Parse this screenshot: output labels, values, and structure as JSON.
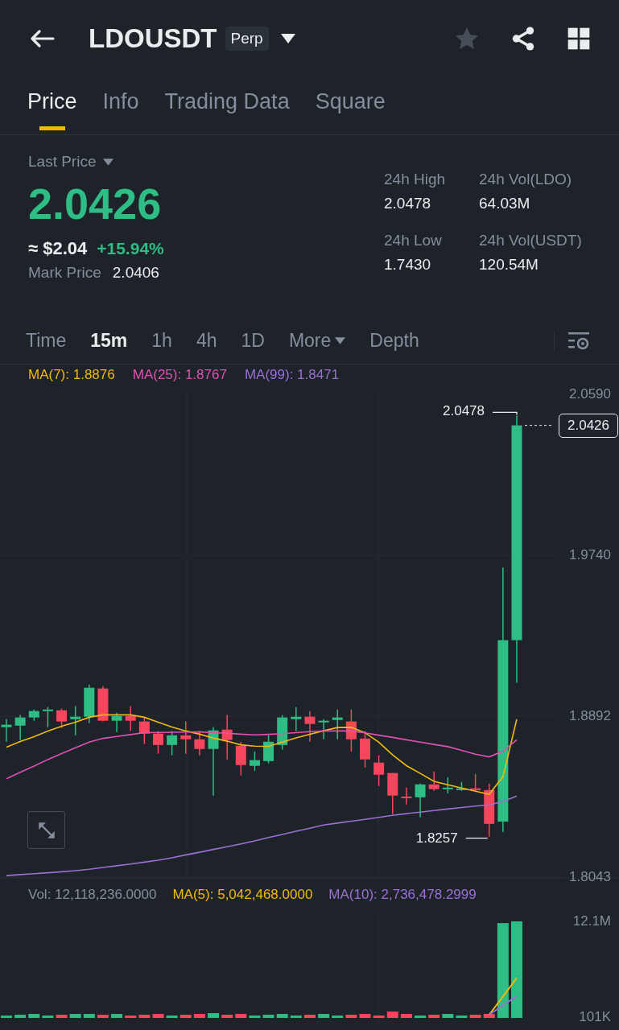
{
  "header": {
    "symbol": "LDOUSDT",
    "badge": "Perp",
    "favorite": false
  },
  "tabs": [
    {
      "label": "Price",
      "selected": true
    },
    {
      "label": "Info",
      "selected": false
    },
    {
      "label": "Trading Data",
      "selected": false
    },
    {
      "label": "Square",
      "selected": false
    }
  ],
  "ticker": {
    "label": "Last Price",
    "last_price": "2.0426",
    "fiat_price": "≈ $2.04",
    "change": "+15.94%",
    "mark_label": "Mark Price",
    "mark_price": "2.0406"
  },
  "stats": [
    {
      "label": "24h High",
      "value": "2.0478"
    },
    {
      "label": "24h Vol(LDO)",
      "value": "64.03M"
    },
    {
      "label": "24h Low",
      "value": "1.7430"
    },
    {
      "label": "24h Vol(USDT)",
      "value": "120.54M"
    }
  ],
  "intervals": [
    {
      "label": "Time",
      "selected": false,
      "dropdown": false
    },
    {
      "label": "15m",
      "selected": true,
      "dropdown": false
    },
    {
      "label": "1h",
      "selected": false,
      "dropdown": false
    },
    {
      "label": "4h",
      "selected": false,
      "dropdown": false
    },
    {
      "label": "1D",
      "selected": false,
      "dropdown": false
    },
    {
      "label": "More",
      "selected": false,
      "dropdown": true
    },
    {
      "label": "Depth",
      "selected": false,
      "dropdown": false
    }
  ],
  "price_chart": {
    "high_label": "2.0478",
    "low_label": "1.8257",
    "current_price": "2.0426",
    "chart_data": {
      "type": "candlestick",
      "ylim": [
        1.8043,
        2.059
      ],
      "yticks": [
        {
          "value": 2.059,
          "label": "2.0590"
        },
        {
          "value": 1.974,
          "label": "1.9740"
        },
        {
          "value": 1.8892,
          "label": "1.8892"
        },
        {
          "value": 1.8043,
          "label": "1.8043"
        }
      ],
      "categories": [
        null,
        null,
        null,
        null,
        null,
        null,
        null,
        null,
        null,
        null,
        null,
        null,
        null,
        null,
        null,
        null,
        null,
        null,
        null,
        null,
        null,
        null,
        null,
        null,
        null,
        null,
        null,
        null,
        null,
        null,
        null,
        null,
        null,
        null,
        null,
        null,
        null,
        null
      ],
      "ohlc": [
        [
          1.8834,
          1.8876,
          1.8757,
          1.8847
        ],
        [
          1.8842,
          1.8898,
          1.8766,
          1.8885
        ],
        [
          1.8885,
          1.8927,
          1.8868,
          1.8919
        ],
        [
          1.8919,
          1.894,
          1.8834,
          1.8927
        ],
        [
          1.8923,
          1.8932,
          1.883,
          1.8864
        ],
        [
          1.8876,
          1.8945,
          1.8791,
          1.8889
        ],
        [
          1.8889,
          1.9059,
          1.8855,
          1.9042
        ],
        [
          1.9038,
          1.9051,
          1.8864,
          1.8868
        ],
        [
          1.8868,
          1.891,
          1.8808,
          1.8893
        ],
        [
          1.8893,
          1.8945,
          1.8813,
          1.8868
        ],
        [
          1.8864,
          1.8885,
          1.8745,
          1.88
        ],
        [
          1.88,
          1.8813,
          1.8694,
          1.874
        ],
        [
          1.874,
          1.8813,
          1.8685,
          1.8791
        ],
        [
          1.8791,
          1.8864,
          1.8694,
          1.877
        ],
        [
          1.877,
          1.8813,
          1.8685,
          1.8719
        ],
        [
          1.8719,
          1.8834,
          1.8473,
          1.8817
        ],
        [
          1.8821,
          1.8898,
          1.8664,
          1.8766
        ],
        [
          1.8736,
          1.8757,
          1.8579,
          1.8634
        ],
        [
          1.863,
          1.8706,
          1.8604,
          1.866
        ],
        [
          1.8655,
          1.8791,
          1.8643,
          1.8757
        ],
        [
          1.874,
          1.8898,
          1.8715,
          1.8885
        ],
        [
          1.8876,
          1.894,
          1.8813,
          1.8889
        ],
        [
          1.8889,
          1.8919,
          1.8757,
          1.8851
        ],
        [
          1.8859,
          1.8876,
          1.877,
          1.8868
        ],
        [
          1.8872,
          1.8927,
          1.877,
          1.8885
        ],
        [
          1.8864,
          1.8927,
          1.8706,
          1.877
        ],
        [
          1.8774,
          1.8813,
          1.8621,
          1.8664
        ],
        [
          1.8647,
          1.8685,
          1.8524,
          1.8583
        ],
        [
          1.8592,
          1.8592,
          1.8375,
          1.8473
        ],
        [
          1.8468,
          1.8515,
          1.8426,
          1.846
        ],
        [
          1.8464,
          1.8536,
          1.8358,
          1.8532
        ],
        [
          1.8532,
          1.86,
          1.8498,
          1.8507
        ],
        [
          1.8507,
          1.857,
          1.8485,
          1.8515
        ],
        [
          1.8502,
          1.8545,
          1.8498,
          1.8511
        ],
        [
          1.8511,
          1.8587,
          1.8498,
          1.8502
        ],
        [
          1.8502,
          1.8536,
          1.8257,
          1.8324
        ],
        [
          1.8336,
          1.9676,
          1.8281,
          1.9293
        ],
        [
          1.9293,
          2.0478,
          1.9068,
          2.0426
        ]
      ],
      "series": [
        {
          "name": "MA(7): 1.8876",
          "type": "line",
          "color": "#f0b90b",
          "values": [
            1.8729,
            1.8758,
            1.8784,
            1.8814,
            1.8839,
            1.886,
            1.8886,
            1.8899,
            1.8899,
            1.8899,
            1.8886,
            1.886,
            1.8835,
            1.8814,
            1.8797,
            1.8777,
            1.876,
            1.8741,
            1.8734,
            1.8733,
            1.8755,
            1.8777,
            1.8797,
            1.8815,
            1.8832,
            1.8833,
            1.8804,
            1.8755,
            1.8688,
            1.8631,
            1.859,
            1.8548,
            1.853,
            1.8513,
            1.8496,
            1.848,
            1.8573,
            1.8876
          ]
        },
        {
          "name": "MA(25): 1.8767",
          "type": "line",
          "color": "#e250b4",
          "values": [
            1.8562,
            1.8596,
            1.8629,
            1.8663,
            1.8695,
            1.8725,
            1.8755,
            1.8775,
            1.8785,
            1.8795,
            1.8805,
            1.8806,
            1.8807,
            1.8808,
            1.8809,
            1.8805,
            1.8802,
            1.8797,
            1.8793,
            1.8796,
            1.88,
            1.8805,
            1.881,
            1.8814,
            1.8814,
            1.8814,
            1.8804,
            1.8792,
            1.878,
            1.8767,
            1.8755,
            1.8743,
            1.8731,
            1.8712,
            1.8691,
            1.8677,
            1.8707,
            1.8767
          ]
        },
        {
          "name": "MA(99): 1.8471",
          "type": "line",
          "color": "#9b6fd6",
          "values": [
            1.8051,
            1.8056,
            1.8061,
            1.8066,
            1.8071,
            1.8077,
            1.8084,
            1.8094,
            1.8103,
            1.8112,
            1.8122,
            1.8132,
            1.8145,
            1.816,
            1.8174,
            1.8189,
            1.8203,
            1.8218,
            1.8234,
            1.8252,
            1.8268,
            1.8285,
            1.8301,
            1.8318,
            1.8328,
            1.8338,
            1.8348,
            1.8358,
            1.8369,
            1.8378,
            1.8386,
            1.8394,
            1.8402,
            1.841,
            1.8418,
            1.8424,
            1.8442,
            1.8471
          ]
        }
      ]
    }
  },
  "volume_chart": {
    "volume_label": {
      "text": "Vol: 12,118,236.0000",
      "color": "#848e9c"
    },
    "chart_data": {
      "type": "bar",
      "ylim": [
        0,
        12118236
      ],
      "yticks": [
        {
          "value": 12100000,
          "label": "12.1M"
        },
        {
          "value": 101000,
          "label": "101K"
        }
      ],
      "categories": [
        null,
        null,
        null,
        null,
        null,
        null,
        null,
        null,
        null,
        null,
        null,
        null,
        null,
        null,
        null,
        null,
        null,
        null,
        null,
        null,
        null,
        null,
        null,
        null,
        null,
        null,
        null,
        null,
        null,
        null,
        null,
        null,
        null,
        null,
        null,
        null,
        null,
        null
      ],
      "colors": [
        "#2ebd85",
        "#2ebd85",
        "#2ebd85",
        "#2ebd85",
        "#f6465d",
        "#2ebd85",
        "#2ebd85",
        "#f6465d",
        "#2ebd85",
        "#f6465d",
        "#f6465d",
        "#f6465d",
        "#2ebd85",
        "#f6465d",
        "#f6465d",
        "#2ebd85",
        "#f6465d",
        "#f6465d",
        "#2ebd85",
        "#2ebd85",
        "#2ebd85",
        "#2ebd85",
        "#f6465d",
        "#2ebd85",
        "#2ebd85",
        "#f6465d",
        "#f6465d",
        "#f6465d",
        "#f6465d",
        "#f6465d",
        "#2ebd85",
        "#f6465d",
        "#2ebd85",
        "#2ebd85",
        "#f6465d",
        "#f6465d",
        "#2ebd85",
        "#2ebd85"
      ],
      "values": [
        300000,
        400000,
        500000,
        300000,
        400000,
        500000,
        500000,
        400000,
        500000,
        300000,
        400000,
        500000,
        300000,
        400000,
        500000,
        600000,
        400000,
        500000,
        300000,
        400000,
        500000,
        300000,
        400000,
        500000,
        300000,
        400000,
        500000,
        300000,
        800000,
        500000,
        300000,
        400000,
        500000,
        300000,
        400000,
        500000,
        11900000,
        12118236
      ],
      "series": [
        {
          "name": "MA(5): 5,042,468.0000",
          "type": "line",
          "color": "#f0b90b",
          "values": [
            null,
            null,
            null,
            null,
            null,
            null,
            null,
            null,
            null,
            null,
            null,
            null,
            null,
            null,
            null,
            null,
            null,
            null,
            null,
            null,
            null,
            null,
            null,
            null,
            null,
            null,
            null,
            null,
            null,
            null,
            null,
            null,
            null,
            null,
            null,
            400000,
            2700000,
            5042468
          ]
        },
        {
          "name": "MA(10): 2,736,478.2999",
          "type": "line",
          "color": "#9b6fd6",
          "values": [
            null,
            null,
            null,
            null,
            null,
            null,
            null,
            null,
            null,
            null,
            null,
            null,
            null,
            null,
            null,
            null,
            null,
            null,
            null,
            null,
            null,
            null,
            null,
            null,
            null,
            null,
            null,
            null,
            null,
            null,
            null,
            null,
            null,
            null,
            null,
            400000,
            1600000,
            2736478
          ]
        }
      ]
    }
  }
}
